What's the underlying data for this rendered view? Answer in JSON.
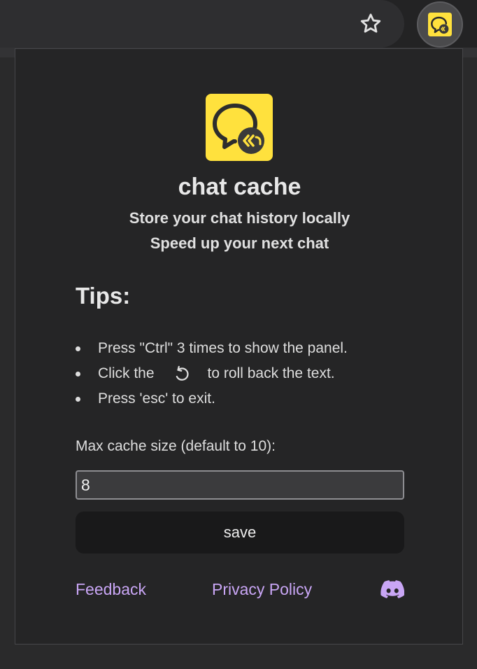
{
  "browser": {
    "bookmark_icon": "star-outline-icon",
    "extension_icon": "chat-cache-extension-icon"
  },
  "popup": {
    "logo_icon": "chat-bubble-rewind-logo",
    "app_name": "chat cache",
    "tagline_1": "Store your chat history locally",
    "tagline_2": "Speed up your next chat",
    "tips_title": "Tips:",
    "tips": {
      "tip1": "Press \"Ctrl\" 3 times to show the panel.",
      "tip2_before": "Click the",
      "tip2_icon": "rollback-icon",
      "tip2_after": "to roll back the text.",
      "tip3": "Press 'esc' to exit."
    },
    "cache_size_label": "Max cache size (default to 10):",
    "cache_size_value": "8",
    "save_label": "save",
    "footer": {
      "feedback_label": "Feedback",
      "privacy_label": "Privacy Policy",
      "discord_icon": "discord-icon"
    }
  },
  "colors": {
    "accent_yellow": "#ffe13d",
    "link_purple": "#c9a6f5",
    "popup_bg": "#252526"
  }
}
